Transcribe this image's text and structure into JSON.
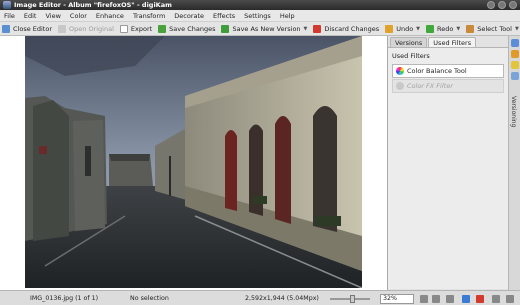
{
  "window": {
    "title": "Image Editor - Album \"firefoxOS\" - digiKam"
  },
  "menu": [
    "File",
    "Edit",
    "View",
    "Color",
    "Enhance",
    "Transform",
    "Decorate",
    "Effects",
    "Settings",
    "Help"
  ],
  "toolbar": {
    "close_editor": "Close Editor",
    "open_original": "Open Original",
    "export": "Export",
    "save_changes": "Save Changes",
    "save_new_version": "Save As New Version",
    "discard_changes": "Discard Changes",
    "undo": "Undo",
    "redo": "Redo",
    "select_tool": "Select Tool"
  },
  "sidepanel": {
    "tabs": [
      "Versions",
      "Used Filters"
    ],
    "active_tab": "Used Filters",
    "section_title": "Used Filters",
    "filters": [
      {
        "label": "Color Balance Tool",
        "enabled": true
      },
      {
        "label": "Color FX Filter",
        "enabled": false
      }
    ],
    "side_label": "Versioning"
  },
  "statusbar": {
    "filename": "IMG_0136.jpg (1 of 1)",
    "selection": "No selection",
    "dimensions": "2,592x1,944 (5.04Mpx)",
    "zoom": "32%"
  },
  "colors": {
    "accent": "#3a7bd5",
    "toolbar_bg": "#e4e4e4"
  }
}
